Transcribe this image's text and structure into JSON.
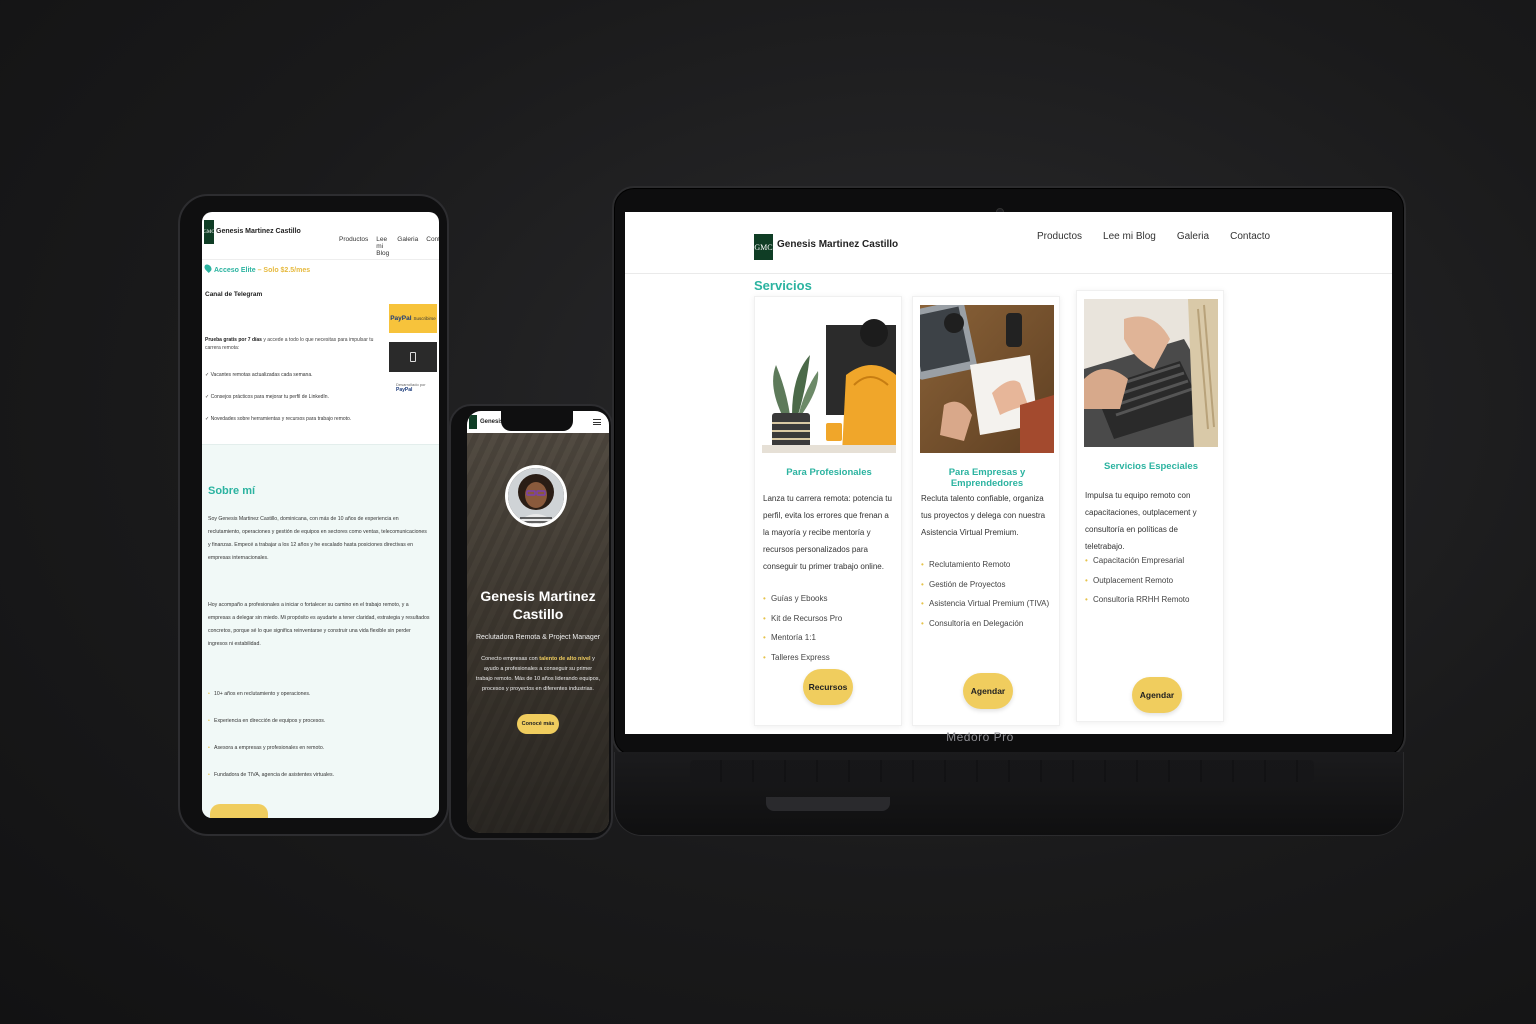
{
  "brand": {
    "logo_text": "GMC",
    "name": "Genesis Martinez Castillo"
  },
  "nav": [
    "Productos",
    "Lee mi Blog",
    "Galeria",
    "Contacto"
  ],
  "laptop": {
    "model_label": "Medoro Pro",
    "section_title": "Servicios",
    "cards": [
      {
        "title": "Para Profesionales",
        "description": "Lanza tu carrera remota: potencia tu perfil, evita los errores que frenan a la mayoría y recibe mentoría y recursos personalizados para conseguir tu primer trabajo online.",
        "items": [
          "Guías y Ebooks",
          "Kit de Recursos Pro",
          "Mentoría 1:1",
          "Talleres Express"
        ],
        "button": "Recursos"
      },
      {
        "title": "Para Empresas y Emprendedores",
        "description": "Recluta talento confiable, organiza tus proyectos y delega con nuestra Asistencia Virtual Premium.",
        "items": [
          "Reclutamiento Remoto",
          "Gestión de Proyectos",
          "Asistencia Virtual Premium (TIVA)",
          "Consultoría en Delegación"
        ],
        "button": "Agendar"
      },
      {
        "title": "Servicios Especiales",
        "description": "Impulsa tu equipo remoto con capacitaciones, outplacement y consultoría en políticas de teletrabajo.",
        "items": [
          "Capacitación Empresarial",
          "Outplacement Remoto",
          "Consultoría RRHH Remoto"
        ],
        "button": "Agendar"
      }
    ]
  },
  "tablet": {
    "access_label": "Acceso Elite",
    "access_price": " – Solo $2.5/mes",
    "channel": "Canal de Telegram",
    "trial_bold": "Prueba gratis por 7 días",
    "trial_rest": " y accede a todo lo que necesitas para impulsar tu carrera remota:",
    "checks": [
      "✓ Vacantes remotas actualizadas cada semana.",
      "✓ Consejos prácticos para mejorar tu perfil de LinkedIn.",
      "✓ Novedades sobre herramientas y recursos para trabajo remoto."
    ],
    "paypal_label": "PayPal",
    "paypal_sub": "Suscribirse",
    "powered_by": "Desarrollado por",
    "powered_brand": "PayPal",
    "about_title": "Sobre mí",
    "about_p1": "Soy Genesis Martinez Castillo, dominicana, con más de 10 años de experiencia en reclutamiento, operaciones y gestión de equipos en sectores como ventas, telecomunicaciones y finanzas. Empecé a trabajar a los 12 años y he escalado hasta posiciones directivas en empresas internacionales.",
    "about_p2": "Hoy acompaño a profesionales a iniciar o fortalecer su camino en el trabajo remoto, y a empresas a delegar sin miedo. Mi propósito es ayudarte a tener claridad, estrategia y resultados concretos, porque sé lo que significa reinventarse y construir una vida flexible sin perder ingresos ni estabilidad.",
    "about_bullets": [
      "10+ años en reclutamiento y operaciones.",
      "Experiencia en dirección de equipos y procesos.",
      "Asesora a empresas y profesionales en remoto.",
      "Fundadora de TIVA, agencia de asistentes virtuales."
    ]
  },
  "phone": {
    "brand_short": "Genesis",
    "name": "Genesis Martinez Castillo",
    "role": "Reclutadora Remota & Project Manager",
    "intro_pre": "Conecto empresas con ",
    "intro_bold": "talento de alto nivel",
    "intro_post": " y ayudo a profesionales a conseguir su primer trabajo remoto. Más de 10 años liderando equipos, procesos y proyectos en diferentes industrias.",
    "button": "Conocé más"
  },
  "colors": {
    "accent": "#2bb3a0",
    "button": "#f0cd5e",
    "logo_bg": "#0f3d25"
  }
}
